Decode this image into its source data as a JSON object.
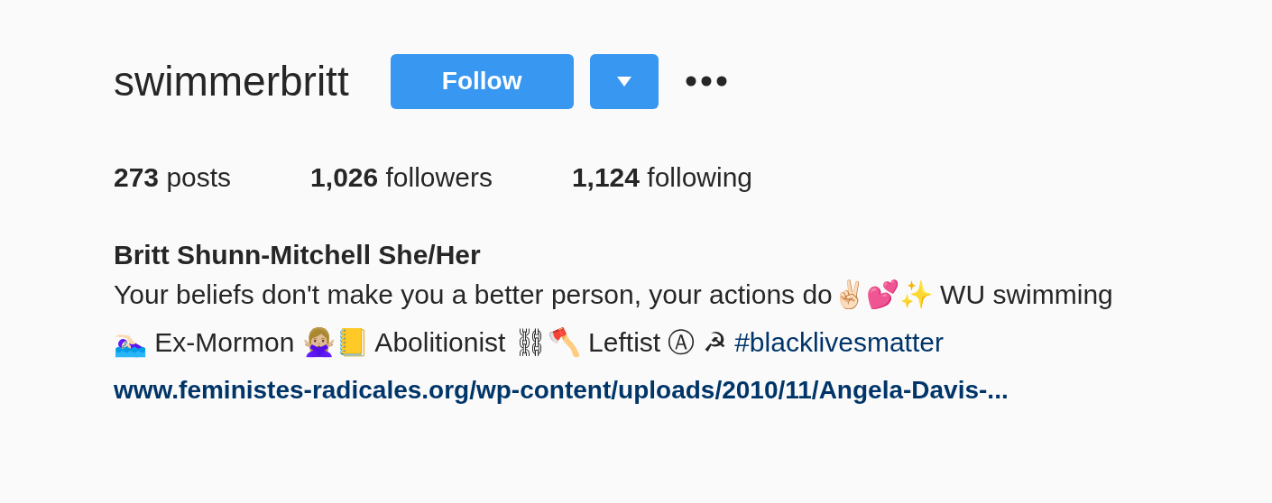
{
  "username": "swimmerbritt",
  "follow_button": {
    "label": "Follow"
  },
  "stats": [
    {
      "count": "273",
      "label": "posts"
    },
    {
      "count": "1,026",
      "label": "followers"
    },
    {
      "count": "1,124",
      "label": "following"
    }
  ],
  "full_name": "Britt Shunn-Mitchell She/Her",
  "bio": {
    "text": "Your beliefs don't make you a better person, your actions do✌🏻💕✨ WU swimming 🏊🏻‍♀️ Ex-Mormon 🙅🏼‍♀️📒 Abolitionist ⛓🪓 Leftist Ⓐ ☭",
    "hashtag": "#blacklivesmatter"
  },
  "website": "www.feministes-radicales.org/wp-content/uploads/2010/11/Angela-Davis-..."
}
